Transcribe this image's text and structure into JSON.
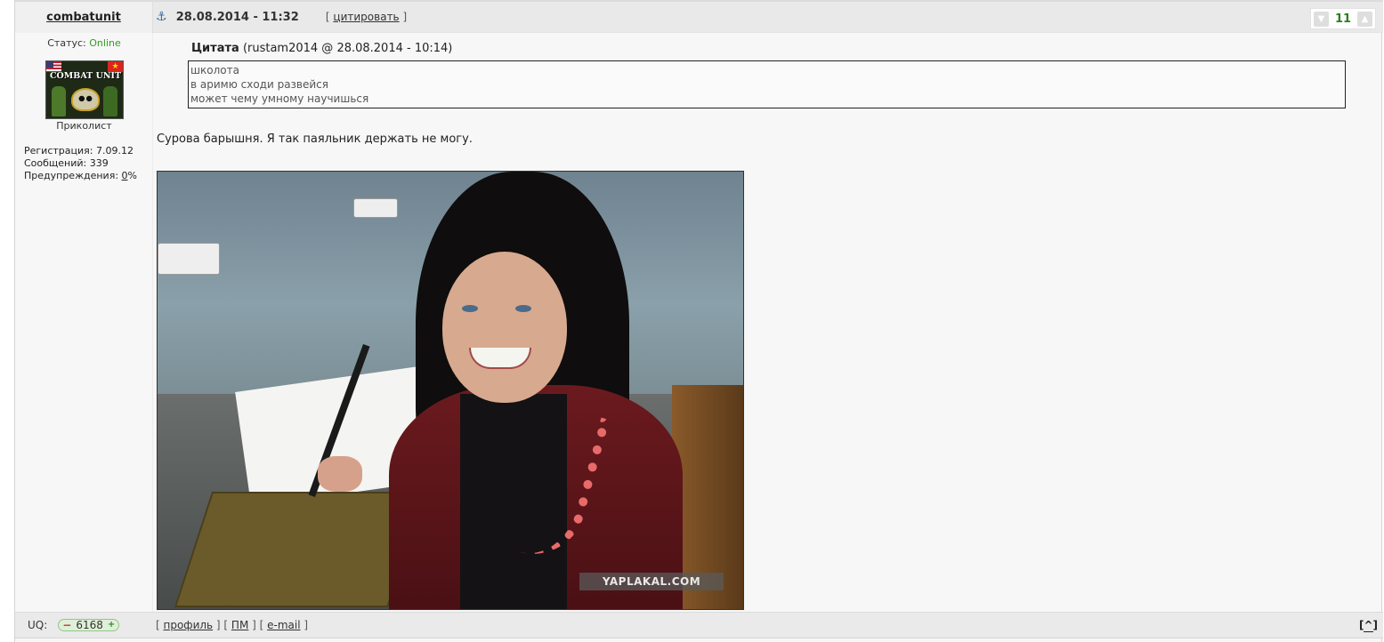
{
  "post": {
    "author": "combatunit",
    "date": "28.08.2014 - 11:32",
    "quote_link": "цитировать",
    "rating": "11"
  },
  "profile": {
    "status_label": "Статус:",
    "status_value": "Online",
    "avatar_text": "COMBAT UNIT",
    "rank": "Приколист",
    "registration": "Регистрация: 7.09.12",
    "messages": "Сообщений: 339",
    "warnings_label": "Предупреждения:",
    "warnings_value": "0",
    "warnings_unit": "%"
  },
  "quote": {
    "label": "Цитата",
    "meta": "(rustam2014 @ 28.08.2014 - 10:14)",
    "lines": [
      "школота",
      "в аримю сходи развейся",
      "может чему умному научишься"
    ]
  },
  "body": {
    "text": "Сурова барышня. Я так паяльник держать не могу.",
    "image_watermark": "YAPLAKAL.COM"
  },
  "footer": {
    "uq_label": "UQ:",
    "uq_value": "6168",
    "uq_minus": "−",
    "uq_plus": "+",
    "link_profile": "профиль",
    "link_pm": "ПМ",
    "link_email": "e-mail",
    "to_top": "^"
  },
  "colors": {
    "online": "#2e9c22",
    "rating": "#2a7f1e"
  },
  "icons": [
    "anchor-icon",
    "thumbs-down-icon",
    "thumbs-up-icon"
  ]
}
